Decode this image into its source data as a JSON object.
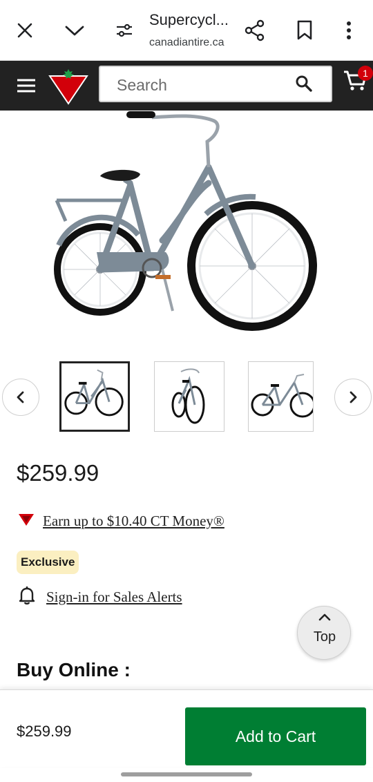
{
  "browser": {
    "page_title": "Supercycl...",
    "url": "canadiantire.ca",
    "icons": [
      "close-icon",
      "chevron-down-icon",
      "tune-icon",
      "share-icon",
      "bookmark-icon",
      "more-vert-icon"
    ]
  },
  "header": {
    "search_placeholder": "Search",
    "cart_count": "1",
    "icons": [
      "hamburger-menu-icon",
      "canadian-tire-logo",
      "search-icon",
      "cart-icon"
    ],
    "colors": {
      "bar": "#222222",
      "logo_red": "#d2000a",
      "badge": "#d2000a"
    }
  },
  "product": {
    "price": "$259.99",
    "ct_money_link": "Earn up to $10.40 CT Money®",
    "exclusive_badge": "Exclusive",
    "sales_alert_link": "Sign-in for Sales Alerts",
    "buy_online_heading": "Buy Online :",
    "thumbnails_visible": 3,
    "selected_thumbnail": 1
  },
  "floating": {
    "top_label": "Top"
  },
  "sticky_bar": {
    "price": "$259.99",
    "add_to_cart_label": "Add to Cart",
    "button_color": "#007e33"
  }
}
